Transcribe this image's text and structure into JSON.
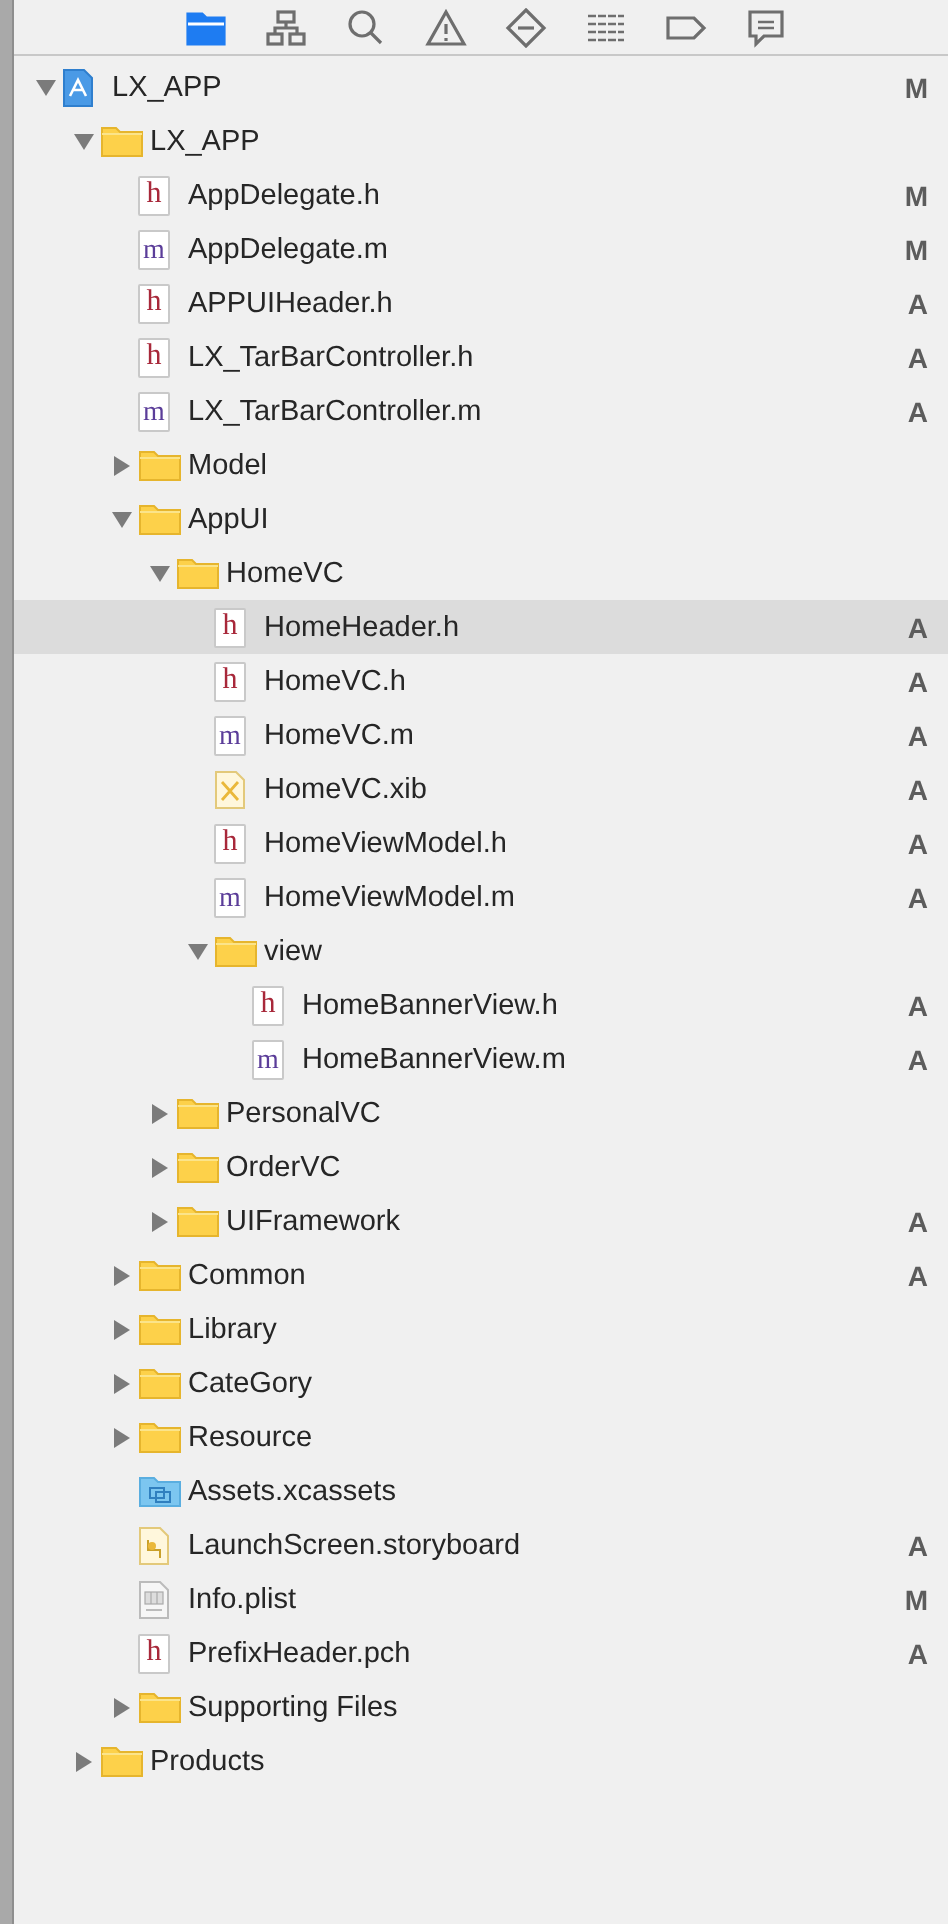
{
  "navigator_tabs": [
    {
      "kind": "project",
      "selected": true
    },
    {
      "kind": "symbol",
      "selected": false
    },
    {
      "kind": "find",
      "selected": false
    },
    {
      "kind": "issue",
      "selected": false
    },
    {
      "kind": "test",
      "selected": false
    },
    {
      "kind": "debug",
      "selected": false
    },
    {
      "kind": "breakpoint",
      "selected": false
    },
    {
      "kind": "report",
      "selected": false
    }
  ],
  "tree": [
    {
      "kind": "project",
      "name": "LX_APP",
      "status": "M",
      "selected": false,
      "expanded": true,
      "children": [
        {
          "kind": "folder",
          "name": "LX_APP",
          "selected": false,
          "expanded": true,
          "children": [
            {
              "kind": "source",
              "letter": "h",
              "name": "AppDelegate.h",
              "status": "M",
              "selected": false
            },
            {
              "kind": "source",
              "letter": "m",
              "name": "AppDelegate.m",
              "status": "M",
              "selected": false
            },
            {
              "kind": "source",
              "letter": "h",
              "name": "APPUIHeader.h",
              "status": "A",
              "selected": false
            },
            {
              "kind": "source",
              "letter": "h",
              "name": "LX_TarBarController.h",
              "status": "A",
              "selected": false
            },
            {
              "kind": "source",
              "letter": "m",
              "name": "LX_TarBarController.m",
              "status": "A",
              "selected": false
            },
            {
              "kind": "folder",
              "name": "Model",
              "selected": false,
              "expanded": false
            },
            {
              "kind": "folder",
              "name": "AppUI",
              "selected": false,
              "expanded": true,
              "children": [
                {
                  "kind": "folder",
                  "name": "HomeVC",
                  "selected": false,
                  "expanded": true,
                  "children": [
                    {
                      "kind": "source",
                      "letter": "h",
                      "name": "HomeHeader.h",
                      "status": "A",
                      "selected": true
                    },
                    {
                      "kind": "source",
                      "letter": "h",
                      "name": "HomeVC.h",
                      "status": "A",
                      "selected": false
                    },
                    {
                      "kind": "source",
                      "letter": "m",
                      "name": "HomeVC.m",
                      "status": "A",
                      "selected": false
                    },
                    {
                      "kind": "xib",
                      "name": "HomeVC.xib",
                      "status": "A",
                      "selected": false
                    },
                    {
                      "kind": "source",
                      "letter": "h",
                      "name": "HomeViewModel.h",
                      "status": "A",
                      "selected": false
                    },
                    {
                      "kind": "source",
                      "letter": "m",
                      "name": "HomeViewModel.m",
                      "status": "A",
                      "selected": false
                    },
                    {
                      "kind": "folder",
                      "name": "view",
                      "selected": false,
                      "expanded": true,
                      "children": [
                        {
                          "kind": "source",
                          "letter": "h",
                          "name": "HomeBannerView.h",
                          "status": "A",
                          "selected": false
                        },
                        {
                          "kind": "source",
                          "letter": "m",
                          "name": "HomeBannerView.m",
                          "status": "A",
                          "selected": false
                        }
                      ]
                    }
                  ]
                },
                {
                  "kind": "folder",
                  "name": "PersonalVC",
                  "selected": false,
                  "expanded": false
                },
                {
                  "kind": "folder",
                  "name": "OrderVC",
                  "selected": false,
                  "expanded": false
                },
                {
                  "kind": "folder",
                  "name": "UIFramework",
                  "status": "A",
                  "selected": false,
                  "expanded": false
                }
              ]
            },
            {
              "kind": "folder",
              "name": "Common",
              "status": "A",
              "selected": false,
              "expanded": false
            },
            {
              "kind": "folder",
              "name": "Library",
              "selected": false,
              "expanded": false
            },
            {
              "kind": "folder",
              "name": "CateGory",
              "selected": false,
              "expanded": false
            },
            {
              "kind": "folder",
              "name": "Resource",
              "selected": false,
              "expanded": false
            },
            {
              "kind": "assets",
              "name": "Assets.xcassets",
              "selected": false
            },
            {
              "kind": "storyboard",
              "name": "LaunchScreen.storyboard",
              "status": "A",
              "selected": false
            },
            {
              "kind": "plist",
              "name": "Info.plist",
              "status": "M",
              "selected": false
            },
            {
              "kind": "source",
              "letter": "h",
              "name": "PrefixHeader.pch",
              "status": "A",
              "selected": false
            },
            {
              "kind": "folder",
              "name": "Supporting Files",
              "selected": false,
              "expanded": false
            }
          ]
        },
        {
          "kind": "folder",
          "name": "Products",
          "selected": false,
          "expanded": false
        }
      ]
    }
  ]
}
